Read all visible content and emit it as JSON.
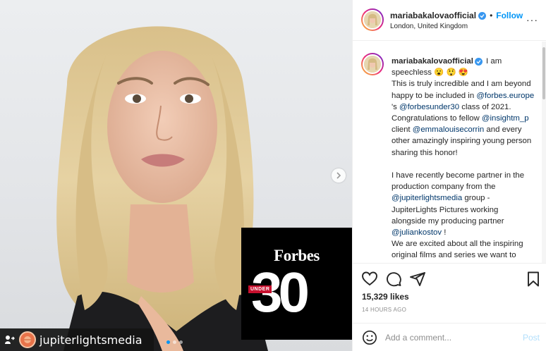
{
  "post": {
    "repost_username": "jupiterlightsmedia",
    "forbes_brand": "Forbes",
    "forbes_under": "UNDER",
    "forbes_number": "30",
    "carousel_dots": 3,
    "carousel_active_index": 0
  },
  "header": {
    "username": "mariabakalovaofficial",
    "separator": "•",
    "follow_label": "Follow",
    "location": "London, United Kingdom",
    "more_label": "···"
  },
  "caption": {
    "username": "mariabakalovaofficial",
    "line1": " I am speechless 😮 😲 😍",
    "p1_a": "This is truly incredible and I am beyond happy to be included in ",
    "mention_forbes_europe": "@forbes.europe",
    "p1_b": " 's ",
    "mention_forbesunder30": "@forbesunder30",
    "p1_c": " class of 2021. Congratulations to fellow ",
    "mention_insightm": "@insightm_p",
    "p1_d": " client ",
    "mention_emma": "@emmalouisecorrin",
    "p1_e": " and every other amazingly inspiring young person sharing this honor!",
    "p2_a": "I have recently become partner in the production company from the ",
    "mention_jupiter": "@jupiterlightsmedia",
    "p2_b": " group - JupiterLights Pictures working alongside my producing partner ",
    "mention_julian": "@juliankostov",
    "p2_c": " !",
    "p3": "We are excited about all the inspiring original films and series we want to create for you over the coming years"
  },
  "actions": {
    "likes": "15,329 likes",
    "timestamp": "14 HOURS AGO"
  },
  "comment_box": {
    "placeholder": "Add a comment...",
    "post_label": "Post"
  },
  "colors": {
    "accent": "#0095f6",
    "mention": "#00376b",
    "verified": "#3897f0",
    "post_disabled": "#b2dffc"
  }
}
